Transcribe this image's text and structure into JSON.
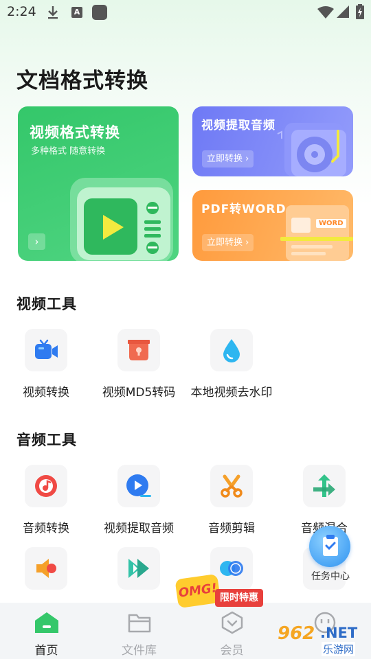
{
  "status_bar": {
    "time": "2:24",
    "notification_letter": "A"
  },
  "page_title": "文档格式转换",
  "cards": {
    "video_format": {
      "title": "视频格式转换",
      "subtitle": "多种格式 随意转换",
      "arrow": "›"
    },
    "extract_audio": {
      "title": "视频提取音频",
      "button": "立即转换 ›"
    },
    "pdf_word": {
      "title": "PDF转WORD",
      "button": "立即转换 ›",
      "tag": "WORD"
    }
  },
  "video_tools": {
    "title": "视频工具",
    "items": [
      {
        "label": "视频转换",
        "icon": "video-camera-icon"
      },
      {
        "label": "视频MD5转码",
        "icon": "lock-box-icon"
      },
      {
        "label": "本地视频去水印",
        "icon": "water-drop-icon"
      }
    ]
  },
  "audio_tools": {
    "title": "音频工具",
    "items": [
      {
        "label": "音频转换",
        "icon": "music-disc-icon"
      },
      {
        "label": "视频提取音频",
        "icon": "play-circle-icon"
      },
      {
        "label": "音频剪辑",
        "icon": "scissors-icon"
      },
      {
        "label": "音频混合",
        "icon": "merge-arrows-icon"
      }
    ],
    "row2_icons": [
      "speaker-icon",
      "fast-forward-icon",
      "toggle-circles-icon",
      "task-doc-icon"
    ]
  },
  "task_center": {
    "label": "任务中心"
  },
  "promo": {
    "badge": "OMG!",
    "label": "限时特惠"
  },
  "bottom_nav": [
    {
      "label": "首页",
      "icon": "home-icon",
      "active": true
    },
    {
      "label": "文件库",
      "icon": "folder-icon",
      "active": false
    },
    {
      "label": "会员",
      "icon": "vip-shield-icon",
      "active": false
    },
    {
      "label": "",
      "icon": "smile-icon",
      "active": false
    }
  ],
  "watermark": {
    "number": "962",
    "domain": ".NET",
    "site": "乐游网"
  },
  "colors": {
    "brand_green": "#34c76a",
    "purple": "#6e79f5",
    "orange": "#ff9a3c",
    "promo_red": "#e8403c"
  }
}
